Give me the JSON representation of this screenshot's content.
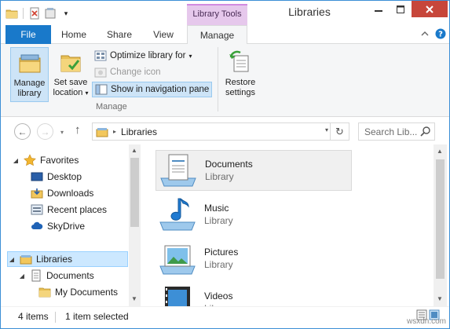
{
  "window": {
    "title": "Libraries",
    "context_tab": "Library Tools"
  },
  "ribbon_tabs": [
    "File",
    "Home",
    "Share",
    "View",
    "Manage"
  ],
  "ribbon": {
    "manage_library": "Manage library",
    "manage_library_line1": "Manage",
    "manage_library_line2": "library",
    "set_save_location_line1": "Set save",
    "set_save_location_line2": "location",
    "optimize_library_for": "Optimize library for",
    "change_icon": "Change icon",
    "show_in_nav_pane": "Show in navigation pane",
    "restore_settings_line1": "Restore",
    "restore_settings_line2": "settings",
    "group_label": "Manage"
  },
  "address": {
    "crumb": "Libraries",
    "search_placeholder": "Search Lib..."
  },
  "nav": {
    "favorites": "Favorites",
    "desktop": "Desktop",
    "downloads": "Downloads",
    "recent_places": "Recent places",
    "skydrive": "SkyDrive",
    "libraries": "Libraries",
    "documents": "Documents",
    "my_documents": "My Documents"
  },
  "libraries": [
    {
      "name": "Documents",
      "type": "Library"
    },
    {
      "name": "Music",
      "type": "Library"
    },
    {
      "name": "Pictures",
      "type": "Library"
    },
    {
      "name": "Videos",
      "type": "Library"
    }
  ],
  "status": {
    "item_count": "4 items",
    "selection": "1 item selected"
  },
  "watermark": "wsxdn.com",
  "colors": {
    "accent": "#1979ca",
    "context_tab": "#e6c8ec",
    "close": "#c7463a",
    "selection": "#cce8ff"
  }
}
